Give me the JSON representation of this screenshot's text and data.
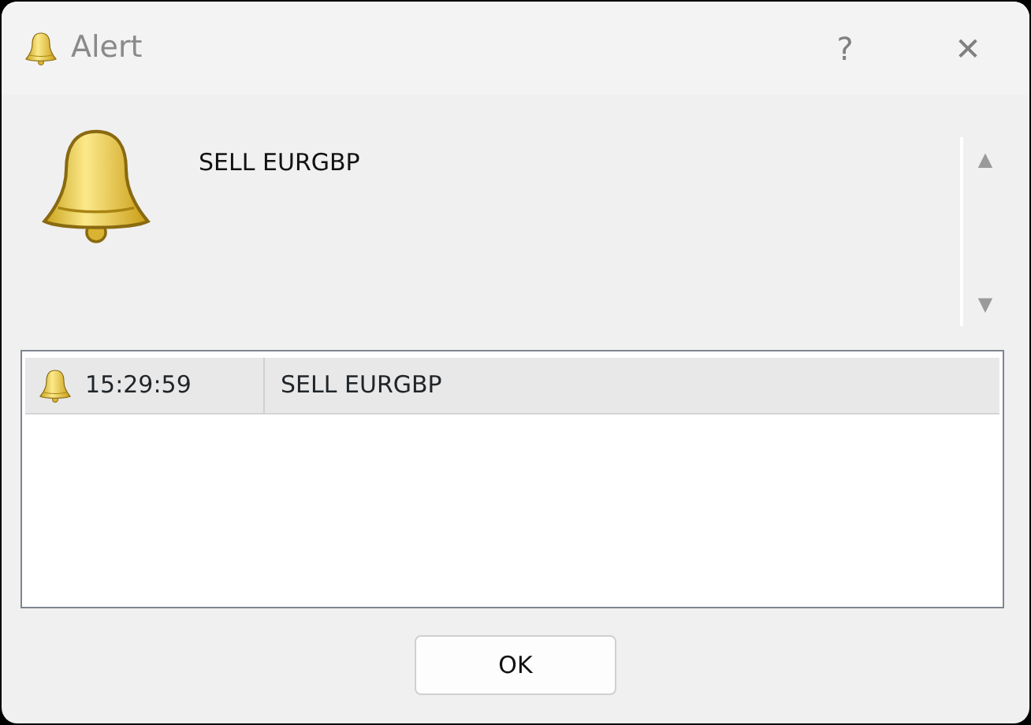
{
  "window": {
    "title": "Alert",
    "help": "?",
    "close": "✕"
  },
  "message": {
    "text": "SELL EURGBP",
    "scroll_up": "▲",
    "scroll_down": "▼"
  },
  "alerts": [
    {
      "time": "15:29:59",
      "text": "SELL EURGBP",
      "selected": true
    }
  ],
  "buttons": [
    "OK"
  ]
}
